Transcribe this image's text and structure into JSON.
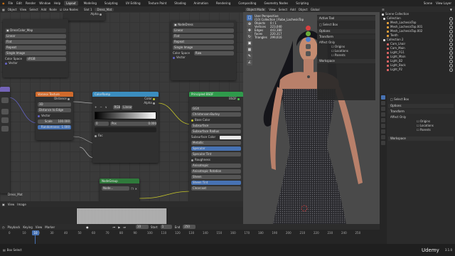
{
  "menu": {
    "items": [
      "File",
      "Edit",
      "Render",
      "Window",
      "Help"
    ],
    "workspaces": [
      "Layout",
      "Modeling",
      "Sculpting",
      "UV Editing",
      "Texture Paint",
      "Shading",
      "Animation",
      "Rendering",
      "Compositing",
      "Geometry Nodes",
      "Scripting"
    ],
    "active_workspace": "Layout",
    "scene": "Scene",
    "view_layer": "View Layer"
  },
  "node_header": [
    "Object",
    "View",
    "Select",
    "Add",
    "Node",
    "Use Nodes",
    "Slot 1",
    "Dress_Mat"
  ],
  "nodes": {
    "alpha_top": {
      "title": "Alpha"
    },
    "image1": {
      "name": "DressColor_Map",
      "interp": "Linear",
      "proj": "Flat",
      "ext": "Repeat",
      "source": "Single Image",
      "cs_label": "Color Space",
      "cs_value": "sRGB",
      "vector": "Vector"
    },
    "image2": {
      "name": "NodeDress",
      "interp": "Linear",
      "proj": "Flat",
      "ext": "Repeat",
      "source": "Single Image",
      "cs_label": "Color Space",
      "cs_value": "Raw",
      "vector": "Vector"
    },
    "voronoi": {
      "title": "Voronoi Texture",
      "out": "Distance",
      "dim": "3D",
      "feature": "Distance to Edge",
      "vector": "Vector",
      "scale_label": "Scale",
      "scale_value": "100.000",
      "rand_label": "Randomness",
      "rand_value": "1.000"
    },
    "ramp": {
      "title": "ColorRamp",
      "color": "Color",
      "alpha": "Alpha",
      "mode": "RGB",
      "interp": "Linear",
      "pos_index": "0",
      "pos_label": "Pos",
      "pos_value": "0.000",
      "fac": "Fac"
    },
    "bsdf": {
      "title": "Principled BSDF",
      "bsdf": "BSDF",
      "dist": "GGX",
      "sss": "Christensen-Burley",
      "inputs": [
        "Base Color",
        "Subsurface",
        "Subsurface Radius",
        "Subsurface Color",
        "Metallic",
        "Specular",
        "Specular Tint",
        "Roughness",
        "Anisotropic",
        "Anisotropic Rotation",
        "Sheen",
        "Sheen Tint",
        "Clearcoat"
      ]
    },
    "group": {
      "title": "NodeGroup",
      "name": "Node..."
    }
  },
  "frame_label": "Dress_Mat",
  "image_editor": {
    "menu": [
      "View",
      "Image"
    ]
  },
  "viewport": {
    "header": [
      "Object Mode",
      "View",
      "Select",
      "Add",
      "Object"
    ],
    "view_name": "User Perspective",
    "collection": "(10) Collection | Robe_LachesisTop",
    "stats": [
      [
        "Objects",
        "0 / 1"
      ],
      [
        "Vertices",
        "223,040"
      ],
      [
        "Edges",
        "443,380"
      ],
      [
        "Faces",
        "220,317"
      ],
      [
        "Triangles",
        "299,616"
      ]
    ],
    "orient": "Global",
    "tool_panel": {
      "title": "Active Tool",
      "tool": "Select Box",
      "options": "Options",
      "transform": "Transform",
      "affect_only": "Affect Only",
      "checks": [
        "Origins",
        "Locations",
        "Parents"
      ],
      "workspace": "Workspace"
    }
  },
  "outliner": {
    "title": "Scene Collection",
    "items": [
      {
        "name": "Collection",
        "color": "#e0e0e0",
        "indent": 0
      },
      {
        "name": "Mesh_LachesisTop",
        "color": "#e9a23b",
        "indent": 1
      },
      {
        "name": "Mesh_LachesisTop.001",
        "color": "#e9a23b",
        "indent": 1
      },
      {
        "name": "Mesh_LachesisTop.002",
        "color": "#e9a23b",
        "indent": 1
      },
      {
        "name": "Teeth",
        "color": "#e9a23b",
        "indent": 1
      },
      {
        "name": "Collection 2",
        "color": "#e0e0e0",
        "indent": 0
      },
      {
        "name": "Cam_Lhair",
        "color": "#e06565",
        "indent": 1
      },
      {
        "name": "Cam_Main",
        "color": "#e06565",
        "indent": 1
      },
      {
        "name": "Light_FG1",
        "color": "#e06565",
        "indent": 1
      },
      {
        "name": "Light_Main",
        "color": "#e06565",
        "indent": 1
      },
      {
        "name": "Light_B2",
        "color": "#e06565",
        "indent": 1
      },
      {
        "name": "Light_Back",
        "color": "#e06565",
        "indent": 1
      },
      {
        "name": "Light_P2",
        "color": "#e06565",
        "indent": 1
      }
    ]
  },
  "properties": {
    "tool": "Select Box",
    "options": "Options",
    "transform": "Transform",
    "affect_only": "Affect Only",
    "checks": [
      "Origins",
      "Locations",
      "Parents"
    ],
    "workspace": "Workspace"
  },
  "timeline": {
    "menu": [
      "Playback",
      "Keying",
      "View",
      "Marker"
    ],
    "current_frame": "10",
    "start_label": "Start",
    "start": "1",
    "end_label": "End",
    "end": "250",
    "ticks": [
      "0",
      "10",
      "20",
      "30",
      "40",
      "50",
      "60",
      "70",
      "80",
      "90",
      "100",
      "110",
      "120",
      "130",
      "140",
      "150",
      "160",
      "170",
      "180",
      "190",
      "200",
      "210",
      "220",
      "230",
      "240",
      "250"
    ]
  },
  "status": {
    "left": "Box Select",
    "version": "3.1.0",
    "watermark": "Udemy"
  },
  "colors": {
    "vector_header": "#7464b8",
    "converter_header": "#3b8dbf",
    "shader_header": "#2f9a4b",
    "texture_header": "#d06a2c",
    "group_header": "#2f7a3b",
    "selection": "#4772b3"
  }
}
